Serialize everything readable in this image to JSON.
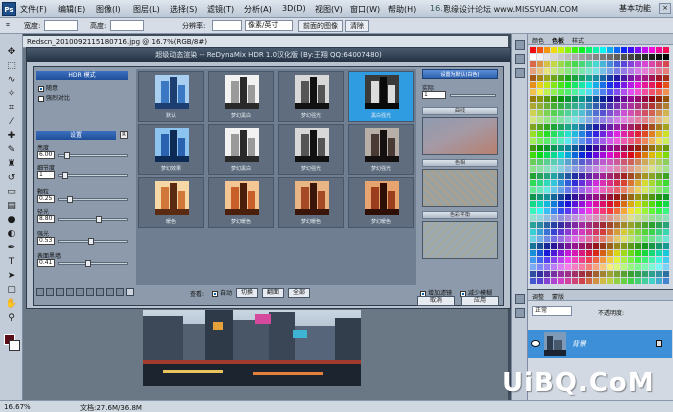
{
  "menubar": {
    "logo": "Ps",
    "items": [
      "文件(F)",
      "编辑(E)",
      "图像(I)",
      "图层(L)",
      "选择(S)",
      "滤镜(T)",
      "分析(A)",
      "3D(D)",
      "视图(V)",
      "窗口(W)",
      "帮助(H)"
    ],
    "zoom": "16.7",
    "site": "思缘设计论坛 www.MISSYUAN.COM",
    "workspace": "基本功能"
  },
  "options": {
    "width_label": "宽度:",
    "height_label": "高度:",
    "resolution_label": "分辨率:",
    "unit": "像素/英寸",
    "front_image_button": "前面的图像",
    "clear_button": "清除"
  },
  "document": {
    "tab_title": "Redscn_2010092115180716.jpg @ 16.7%(RGB/8#)"
  },
  "dialog": {
    "title": "超级动态渲染 -- ReDynaMix HDR 1.0汉化版 (By:王翔  QQ:64007480)",
    "hdr_mode_label": "HDR 模式",
    "checkbox_1": "随意",
    "checkbox_2": "强烈对比",
    "settings_label": "设置",
    "params": [
      {
        "label": "亮度",
        "value": "6.00",
        "pos": 0.08
      },
      {
        "label": "细节度",
        "value": "1",
        "pos": 0.05
      },
      {
        "label": "颗粒",
        "value": "0.25",
        "pos": 0.12
      },
      {
        "label": "径光",
        "value": "8.80",
        "pos": 0.58
      },
      {
        "label": "强光",
        "value": "0.53",
        "pos": 0.45
      },
      {
        "label": "表面黑墙",
        "value": "0.41",
        "pos": 0.4
      }
    ],
    "thumbnails": [
      {
        "caption": "默认",
        "style": "blue"
      },
      {
        "caption": "梦幻黑白",
        "style": "bw"
      },
      {
        "caption": "梦幻强光",
        "style": "dark"
      },
      {
        "caption": "黑白强光",
        "style": "bw2"
      },
      {
        "caption": "梦幻效果",
        "style": "blue2"
      },
      {
        "caption": "梦幻黑白",
        "style": "bw"
      },
      {
        "caption": "梦幻强光",
        "style": "dark"
      },
      {
        "caption": "梦幻强光",
        "style": "dark2"
      },
      {
        "caption": "暖色",
        "style": "warm"
      },
      {
        "caption": "梦幻暖色",
        "style": "warm2"
      },
      {
        "caption": "梦幻暖色",
        "style": "warm3"
      },
      {
        "caption": "梦幻暖色",
        "style": "warm4"
      }
    ],
    "selected_index": 3,
    "defaults_button": "设置为默认(白色)",
    "recent_label": "实际",
    "recent_value": "1",
    "section_1": "曲线",
    "section_2": "色相",
    "section_3": "色彩平衡",
    "view_label": "查看:",
    "auto_label": "自动",
    "buttons": [
      "切换",
      "翻面",
      "全部"
    ],
    "chk_add_filter": "增加滤镜",
    "chk_reduce_blur": "减少模糊",
    "cancel": "取消",
    "apply": "应用"
  },
  "swatches": {
    "tab_1": "颜色",
    "tab_2": "色板",
    "tab_3": "样式"
  },
  "layers": {
    "tab_1": "调整",
    "tab_2": "蒙版",
    "mode": "正常",
    "opacity_label": "不透明度:",
    "layer_name": "背景"
  },
  "status": {
    "zoom": "16.67%",
    "doc_info": "文档:27.6M/36.8M"
  },
  "watermark": "UiBQ.CoM"
}
